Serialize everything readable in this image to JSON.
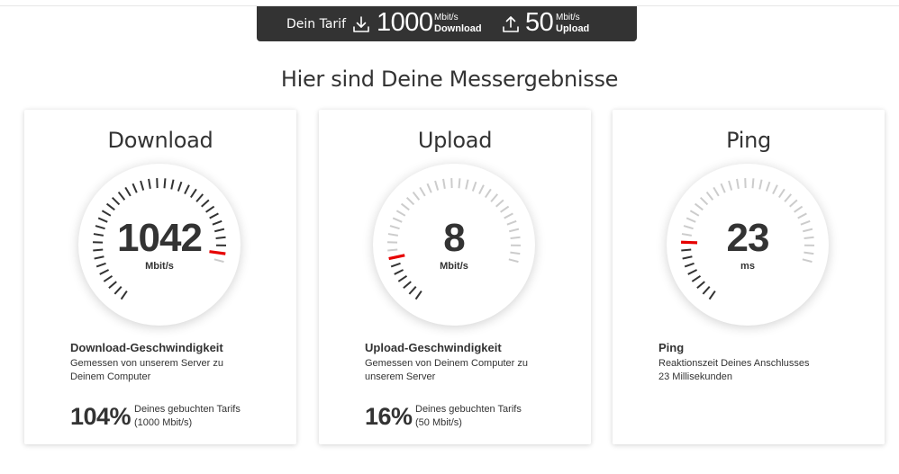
{
  "tariff": {
    "label": "Dein Tarif",
    "download_value": "1000",
    "download_unit": "Mbit/s",
    "download_label": "Download",
    "upload_value": "50",
    "upload_unit": "Mbit/s",
    "upload_label": "Upload",
    "icons": {
      "download": "download-icon",
      "upload": "upload-icon"
    }
  },
  "title": "Hier sind Deine Messergebnisse",
  "colors": {
    "accent": "#e60000",
    "bar": "#333333",
    "tick_active": "#333333",
    "tick_inactive": "#cccccc"
  },
  "cards": [
    {
      "title": "Download",
      "value": "1042",
      "unit": "Mbit/s",
      "gauge_level": 0.98,
      "heading": "Download-Geschwindigkeit",
      "desc_line1": "Gemessen von unserem Server zu",
      "desc_line2": "Deinem Computer",
      "percent": "104%",
      "percent_line1": "Deines gebuchten Tarifs",
      "percent_line2": "(1000 Mbit/s)"
    },
    {
      "title": "Upload",
      "value": "8",
      "unit": "Mbit/s",
      "gauge_level": 0.18,
      "heading": "Upload-Geschwindigkeit",
      "desc_line1": "Gemessen von Deinem Computer zu",
      "desc_line2": "unserem Server",
      "percent": "16%",
      "percent_line1": "Deines gebuchten Tarifs",
      "percent_line2": "(50 Mbit/s)"
    },
    {
      "title": "Ping",
      "value": "23",
      "unit": "ms",
      "gauge_level": 0.24,
      "heading": "Ping",
      "desc_line1": "Reaktionszeit Deines Anschlusses",
      "desc_line2": "23 Millisekunden"
    }
  ]
}
